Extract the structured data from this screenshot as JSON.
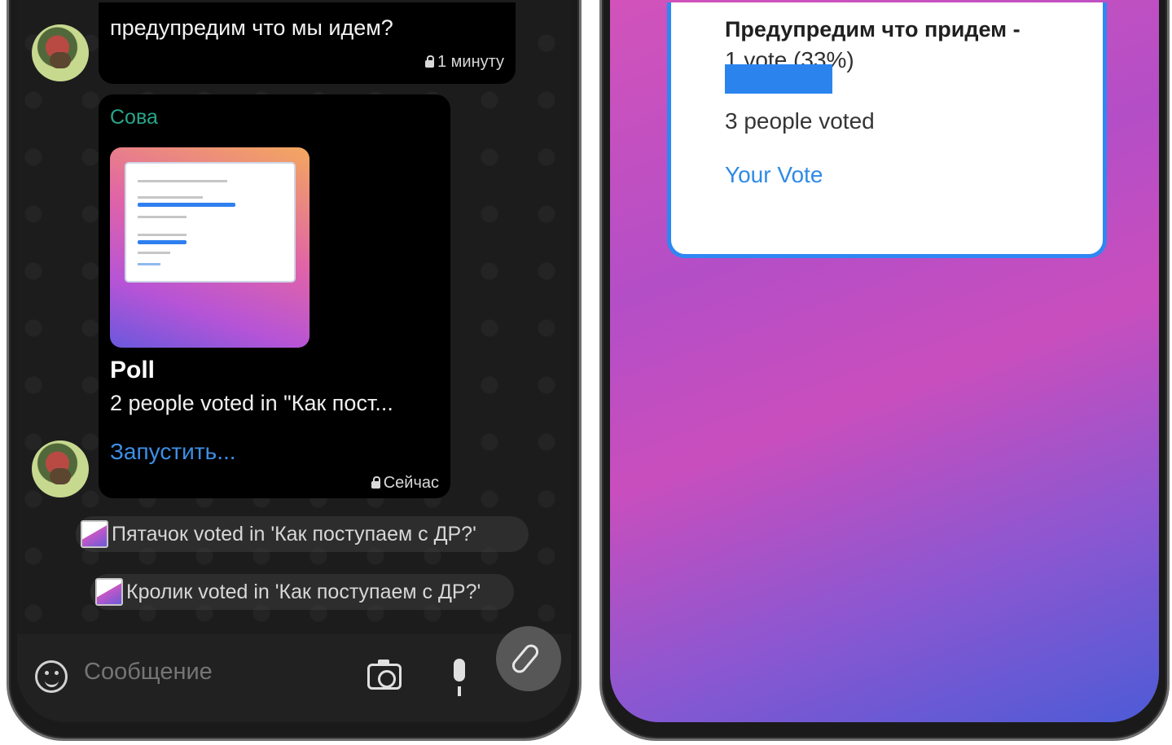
{
  "left": {
    "message_top": {
      "text": "предупредим что мы идем?",
      "time": "1 минуту"
    },
    "poll_message": {
      "sender": "Сова",
      "title": "Poll",
      "description": "2 people voted in \"Как пост...",
      "link": "Запустить...",
      "time": "Сейчас",
      "thumbnail_progress": [
        0.6,
        0.3
      ]
    },
    "system_messages": [
      "Пятачок voted in 'Как поступаем с ДР?'",
      "Кролик voted in 'Как поступаем с ДР?'"
    ],
    "composer": {
      "placeholder": "Сообщение"
    }
  },
  "right": {
    "option_label": "Предупредим что придем -",
    "option_votes": "1 vote (33%)",
    "option_percent": 33,
    "people_voted": "3 people voted",
    "your_vote": "Your Vote"
  },
  "colors": {
    "accent": "#2e87f2",
    "sender": "#27a68a",
    "link": "#3d8fe6"
  }
}
